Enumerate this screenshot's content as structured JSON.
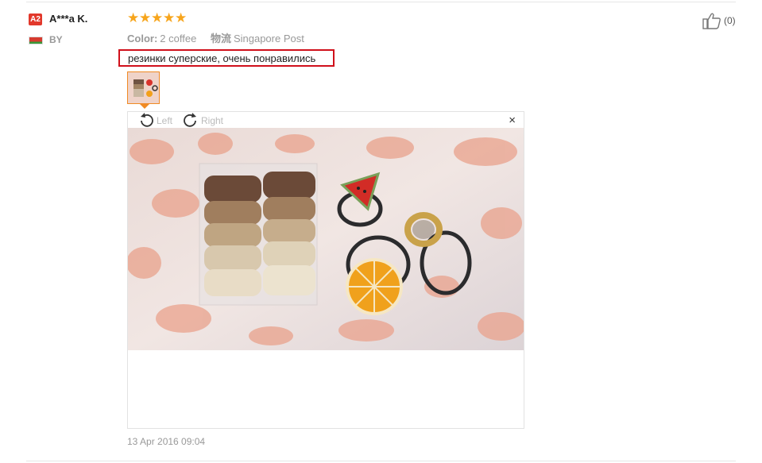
{
  "review": {
    "user": {
      "level_badge": "A2",
      "name": "A***a K.",
      "country": "BY"
    },
    "rating": 5,
    "color_label": "Color:",
    "color_value": "2 coffee",
    "shipping_label": "物流",
    "shipping_value": "Singapore Post",
    "feedback": "резинки суперские, очень понравились",
    "viewer": {
      "rotate_left": "Left",
      "rotate_right": "Right",
      "close_symbol": "×"
    },
    "date": "13 Apr 2016 09:04",
    "helpful_count": "(0)"
  },
  "colors": {
    "accent_star": "#f7a51c",
    "highlight_border": "#d0101b",
    "thumb_border": "#f08a24"
  }
}
